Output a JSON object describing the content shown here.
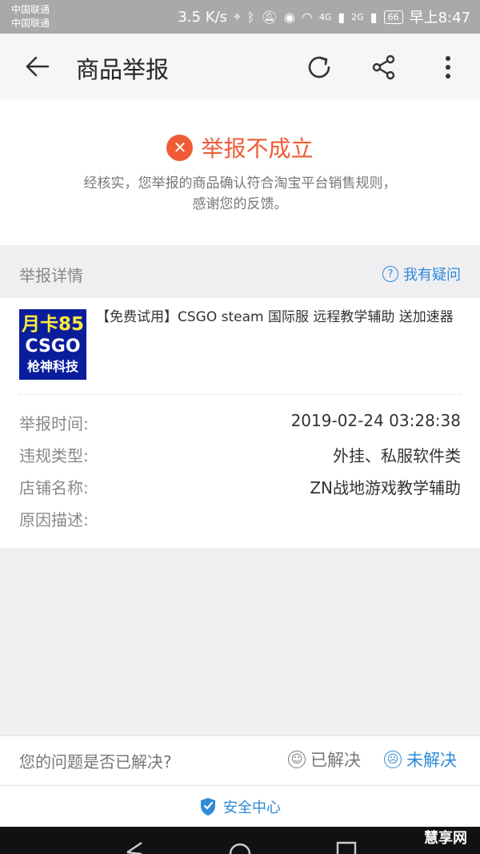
{
  "status_bar": {
    "carrier_1": "中国联通",
    "carrier_2": "中国联通",
    "speed": "3.5 K/s",
    "signal_1": "4G",
    "signal_2": "2G",
    "battery": "66",
    "time": "早上8:47"
  },
  "header": {
    "title": "商品举报",
    "icons": [
      "back-arrow-icon",
      "refresh-icon",
      "share-icon",
      "more-icon"
    ]
  },
  "result": {
    "title": "举报不成立",
    "description_line1": "经核实，您举报的商品确认符合淘宝平台销售规则，",
    "description_line2": "感谢您的反馈。",
    "status_color": "#ef5b36"
  },
  "details": {
    "section_label": "举报详情",
    "faq_link": "我有疑问",
    "product": {
      "thumb_line1": "月卡85",
      "thumb_line2": "CSGO",
      "thumb_line3": "枪神科技",
      "title": "【免费试用】CSGO steam 国际服 远程教学辅助 送加速器"
    },
    "rows": [
      {
        "label": "举报时间:",
        "value": "2019-02-24 03:28:38"
      },
      {
        "label": "违规类型:",
        "value": "外挂、私服软件类"
      },
      {
        "label": "店铺名称:",
        "value": "ZN战地游戏教学辅助"
      },
      {
        "label": "原因描述:",
        "value": ""
      }
    ]
  },
  "feedback": {
    "question": "您的问题是否已解决?",
    "resolved": "已解决",
    "unresolved": "未解决",
    "accent": "#2f8ad8"
  },
  "footer": {
    "safety_center": "安全中心"
  },
  "watermark": "慧享网"
}
